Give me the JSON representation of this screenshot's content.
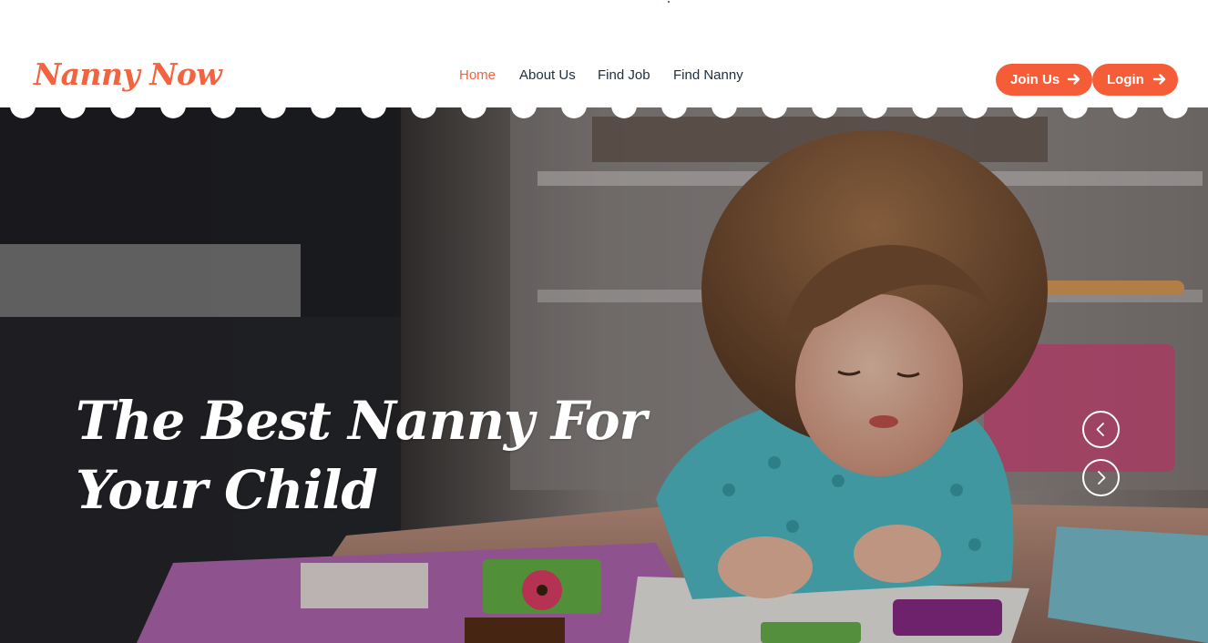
{
  "brand": {
    "name": "Nanny Now",
    "color": "#f26440"
  },
  "nav": {
    "items": [
      {
        "label": "Home",
        "active": true
      },
      {
        "label": "About Us",
        "active": false
      },
      {
        "label": "Find Job",
        "active": false
      },
      {
        "label": "Find Nanny",
        "active": false
      }
    ]
  },
  "actions": {
    "join_label": "Join Us",
    "login_label": "Login",
    "button_color": "#f45d37",
    "icon": "arrow-right-icon"
  },
  "hero": {
    "title": "The Best Nanny For Your Child",
    "prev_icon": "chevron-left-icon",
    "next_icon": "chevron-right-icon",
    "image": "child-reading-book-photo"
  }
}
